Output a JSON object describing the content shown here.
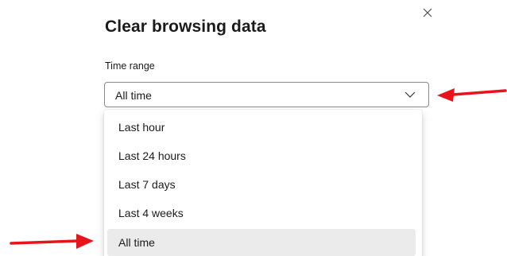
{
  "dialog": {
    "title": "Clear browsing data",
    "close_icon": "close-icon"
  },
  "time_range": {
    "label": "Time range",
    "selected_value": "All time",
    "chevron_icon": "chevron-down-icon",
    "options": [
      {
        "label": "Last hour",
        "selected": false
      },
      {
        "label": "Last 24 hours",
        "selected": false
      },
      {
        "label": "Last 7 days",
        "selected": false
      },
      {
        "label": "Last 4 weeks",
        "selected": false
      },
      {
        "label": "All time",
        "selected": true
      }
    ]
  },
  "annotations": {
    "arrow_color": "#e8141b"
  }
}
